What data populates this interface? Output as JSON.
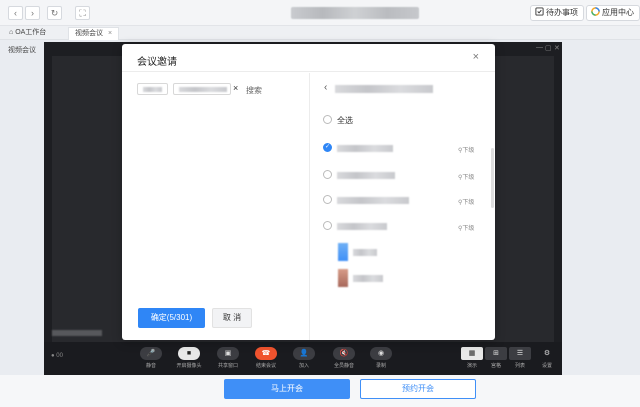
{
  "browser": {
    "back_glyph": "‹",
    "forward_glyph": "›",
    "refresh_glyph": "↻",
    "fullscreen_glyph": "⛶",
    "todo_label": "待办事项",
    "app_center_label": "应用中心"
  },
  "tabs": [
    {
      "label": "OA工作台",
      "icon": "home-icon"
    },
    {
      "label": "视频会议",
      "close": "×"
    }
  ],
  "page": {
    "title": "视频会议"
  },
  "modal": {
    "title": "会议邀请",
    "close_glyph": "×",
    "search_label": "搜索",
    "chip_remove_glyph": "×",
    "confirm_label": "确定(5/301)",
    "cancel_label": "取 消",
    "back_glyph": "‹",
    "select_all_label": "全选",
    "sub_link_label": "下级",
    "rows": 4
  },
  "controls": [
    {
      "label": "静音",
      "glyph": "🎤"
    },
    {
      "label": "开启摄像头",
      "glyph": "■"
    },
    {
      "label": "共享窗口",
      "glyph": "▣"
    },
    {
      "label": "结束会议",
      "glyph": "☎"
    },
    {
      "label": "加入",
      "glyph": "👤"
    },
    {
      "label": "全员静音",
      "glyph": "🔇"
    },
    {
      "label": "录制",
      "glyph": "◉"
    }
  ],
  "layouts": [
    {
      "label": "演示",
      "glyph": "▦"
    },
    {
      "label": "宫格",
      "glyph": "⊞"
    },
    {
      "label": "列表",
      "glyph": "☰"
    },
    {
      "label": "设置",
      "glyph": "⚙"
    }
  ],
  "timer": "00",
  "bottom": {
    "start_now_label": "马上开会",
    "book_label": "预约开会"
  },
  "colors": {
    "primary": "#2f86f6",
    "end_call": "#f0532e",
    "video_bg": "#1d1e22"
  }
}
